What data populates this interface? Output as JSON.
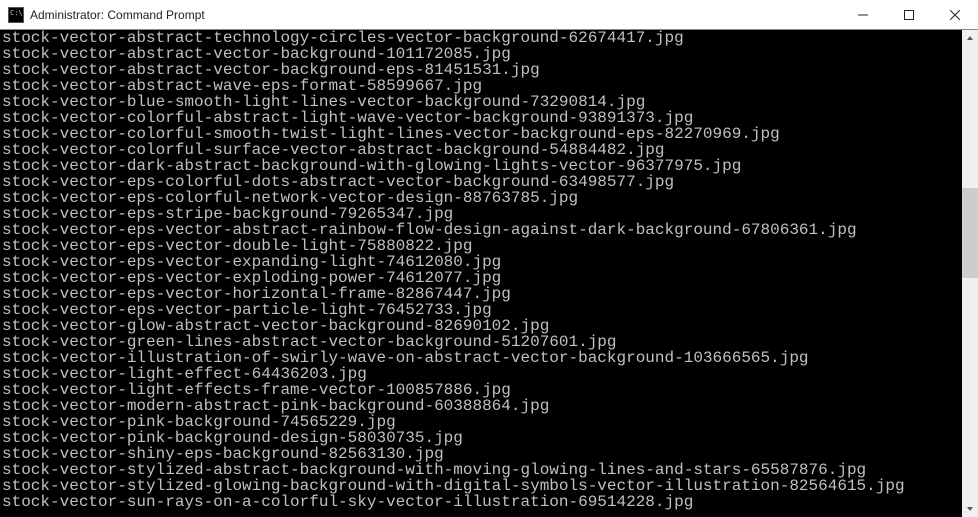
{
  "window": {
    "title": "Administrator: Command Prompt"
  },
  "terminal": {
    "lines": [
      "stock-vector-abstract-technology-circles-vector-background-62674417.jpg",
      "stock-vector-abstract-vector-background-101172085.jpg",
      "stock-vector-abstract-vector-background-eps-81451531.jpg",
      "stock-vector-abstract-wave-eps-format-58599667.jpg",
      "stock-vector-blue-smooth-light-lines-vector-background-73290814.jpg",
      "stock-vector-colorful-abstract-light-wave-vector-background-93891373.jpg",
      "stock-vector-colorful-smooth-twist-light-lines-vector-background-eps-82270969.jpg",
      "stock-vector-colorful-surface-vector-abstract-background-54884482.jpg",
      "stock-vector-dark-abstract-background-with-glowing-lights-vector-96377975.jpg",
      "stock-vector-eps-colorful-dots-abstract-vector-background-63498577.jpg",
      "stock-vector-eps-colorful-network-vector-design-88763785.jpg",
      "stock-vector-eps-stripe-background-79265347.jpg",
      "stock-vector-eps-vector-abstract-rainbow-flow-design-against-dark-background-67806361.jpg",
      "stock-vector-eps-vector-double-light-75880822.jpg",
      "stock-vector-eps-vector-expanding-light-74612080.jpg",
      "stock-vector-eps-vector-exploding-power-74612077.jpg",
      "stock-vector-eps-vector-horizontal-frame-82867447.jpg",
      "stock-vector-eps-vector-particle-light-76452733.jpg",
      "stock-vector-glow-abstract-vector-background-82690102.jpg",
      "stock-vector-green-lines-abstract-vector-background-51207601.jpg",
      "stock-vector-illustration-of-swirly-wave-on-abstract-vector-background-103666565.jpg",
      "stock-vector-light-effect-64436203.jpg",
      "stock-vector-light-effects-frame-vector-100857886.jpg",
      "stock-vector-modern-abstract-pink-background-60388864.jpg",
      "stock-vector-pink-background-74565229.jpg",
      "stock-vector-pink-background-design-58030735.jpg",
      "stock-vector-shiny-eps-background-82563130.jpg",
      "stock-vector-stylized-abstract-background-with-moving-glowing-lines-and-stars-65587876.jpg",
      "stock-vector-stylized-glowing-background-with-digital-symbols-vector-illustration-82564615.jpg",
      "stock-vector-sun-rays-on-a-colorful-sky-vector-illustration-69514228.jpg"
    ]
  }
}
